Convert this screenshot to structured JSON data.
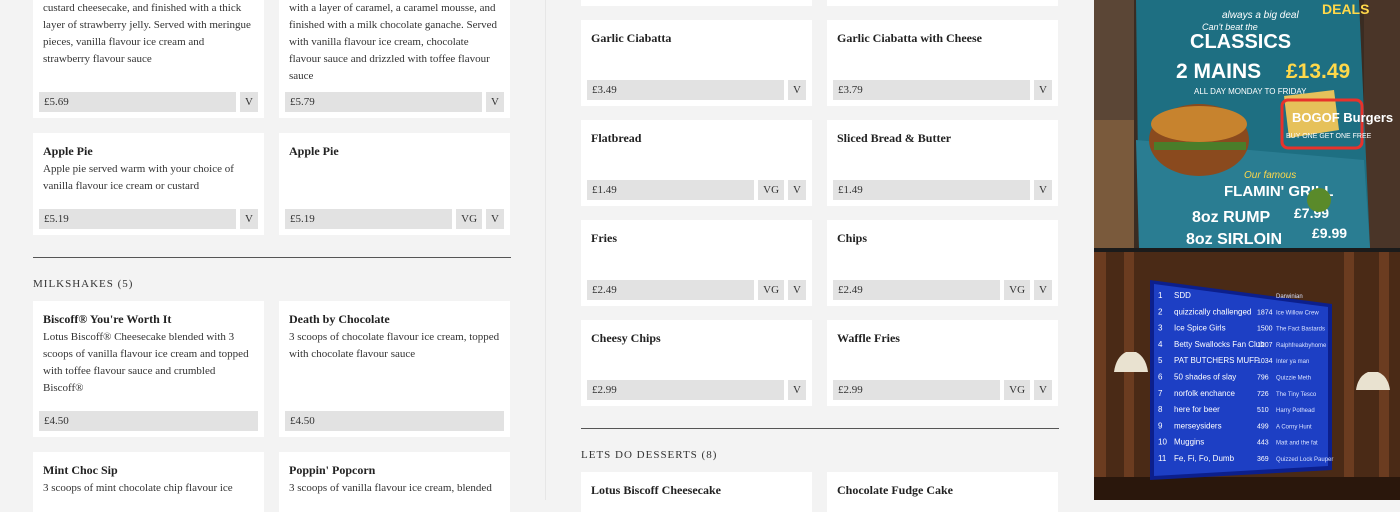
{
  "left": {
    "top_cards": [
      {
        "title": "",
        "desc": "custard cheesecake, and finished with a thick layer of strawberry jelly. Served with meringue pieces, vanilla flavour ice cream and strawberry flavour sauce",
        "price": "£5.69",
        "tags": [
          "V"
        ]
      },
      {
        "title": "",
        "desc": "with a layer of caramel, a caramel mousse, and finished with a milk chocolate ganache. Served with vanilla flavour ice cream, chocolate flavour sauce and drizzled with toffee flavour sauce",
        "price": "£5.79",
        "tags": [
          "V"
        ]
      }
    ],
    "pie_cards": [
      {
        "title": "Apple Pie",
        "desc": "Apple pie served warm with your choice of vanilla flavour ice cream or custard",
        "price": "£5.19",
        "tags": [
          "V"
        ]
      },
      {
        "title": "Apple Pie",
        "desc": "",
        "price": "£5.19",
        "tags": [
          "VG",
          "V"
        ]
      }
    ],
    "milkshakes_title": "MILKSHAKES (5)",
    "milkshakes": [
      {
        "title": "Biscoff® You're Worth It",
        "desc": "Lotus Biscoff® Cheesecake blended with 3 scoops of vanilla flavour ice cream and topped with toffee flavour sauce and crumbled Biscoff®",
        "price": "£4.50",
        "tags": []
      },
      {
        "title": "Death by Chocolate",
        "desc": "3 scoops of chocolate flavour ice cream, topped with chocolate flavour sauce",
        "price": "£4.50",
        "tags": []
      },
      {
        "title": "Mint Choc Sip",
        "desc": "3 scoops of mint chocolate chip flavour ice",
        "price": "",
        "tags": []
      },
      {
        "title": "Poppin' Popcorn",
        "desc": "3 scoops of vanilla flavour ice cream, blended",
        "price": "",
        "tags": []
      }
    ]
  },
  "mid": {
    "sides": [
      {
        "title": "Garlic Ciabatta",
        "price": "£3.49",
        "tags": [
          "V"
        ]
      },
      {
        "title": "Garlic Ciabatta with Cheese",
        "price": "£3.79",
        "tags": [
          "V"
        ]
      },
      {
        "title": "Flatbread",
        "price": "£1.49",
        "tags": [
          "VG",
          "V"
        ]
      },
      {
        "title": "Sliced Bread & Butter",
        "price": "£1.49",
        "tags": [
          "V"
        ]
      },
      {
        "title": "Fries",
        "price": "£2.49",
        "tags": [
          "VG",
          "V"
        ]
      },
      {
        "title": "Chips",
        "price": "£2.49",
        "tags": [
          "VG",
          "V"
        ]
      },
      {
        "title": "Cheesy Chips",
        "price": "£2.99",
        "tags": [
          "V"
        ]
      },
      {
        "title": "Waffle Fries",
        "price": "£2.99",
        "tags": [
          "VG",
          "V"
        ]
      }
    ],
    "desserts_title": "LETS DO DESSERTS (8)",
    "desserts": [
      {
        "title": "Lotus Biscoff Cheesecake"
      },
      {
        "title": "Chocolate Fudge Cake"
      }
    ]
  },
  "photos": {
    "poster": {
      "line1": "Can't beat the",
      "line2": "CLASSICS",
      "line3": "2 MAINS",
      "line4": "£13.49",
      "line5": "ALL DAY MONDAY TO FRIDAY",
      "deals": "DEALS",
      "always": "always a big deal",
      "bogof": "BOGOF Burgers",
      "bogof_sub": "BUY ONE GET ONE FREE",
      "famous": "Our famous",
      "grill": "FLAMIN' GRILL",
      "rump": "8oz RUMP",
      "rump_price": "£7.99",
      "sirloin": "8oz SIRLOIN",
      "sirloin_price": "£9.99"
    },
    "scoreboard": {
      "rows": [
        {
          "rank": "1",
          "team": "SDD",
          "score": ""
        },
        {
          "rank": "2",
          "team": "quizzically challenged",
          "score": "1874"
        },
        {
          "rank": "3",
          "team": "Ice Spice Girls",
          "score": "1500"
        },
        {
          "rank": "4",
          "team": "Betty Swallocks Fan Club",
          "score": "1207"
        },
        {
          "rank": "5",
          "team": "PAT BUTCHERS MUFF",
          "score": "1034"
        },
        {
          "rank": "6",
          "team": "50 shades of slay",
          "score": "796"
        },
        {
          "rank": "7",
          "team": "norfolk enchance",
          "score": "726"
        },
        {
          "rank": "8",
          "team": "here for beer",
          "score": "510"
        },
        {
          "rank": "9",
          "team": "merseysiders",
          "score": "499"
        },
        {
          "rank": "10",
          "team": "Muggins",
          "score": "443"
        },
        {
          "rank": "11",
          "team": "Fe, Fi, Fo, Dumb",
          "score": "369"
        }
      ],
      "right": [
        "Darwinian",
        "Ice Willow Crew",
        "The Fact Bastards",
        "Ralphfreakbyhome",
        "Inter ya man",
        "Quizzie Meth",
        "The Tiny Tesco",
        "Harry Pothead",
        "A Corny Hunt",
        "Matt and the fat",
        "Quizzed Lock Pauper"
      ]
    },
    "colors": {
      "accent_red": "#e8322b",
      "screen_blue": "#1d3fc4",
      "poster_teal": "#1e6f82"
    }
  }
}
